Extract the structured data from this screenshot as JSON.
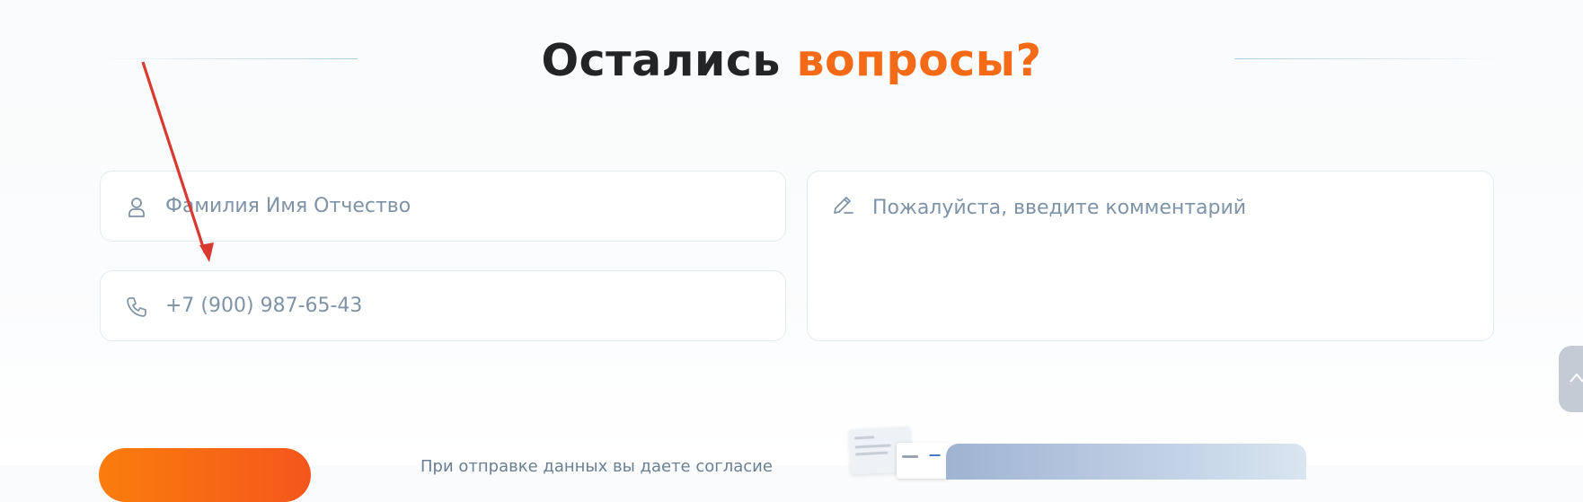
{
  "header": {
    "title_main": "Остались",
    "title_accent": "вопросы?"
  },
  "form": {
    "name_placeholder": "Фамилия Имя Отчество",
    "phone_placeholder": "+7 (900) 987-65-43",
    "comment_placeholder": "Пожалуйста, введите комментарий"
  },
  "footer": {
    "consent_text": "При отправке данных вы даете согласие"
  },
  "icons": {
    "name": "user-icon",
    "phone": "phone-icon",
    "comment": "pencil-icon",
    "scroll_top": "chevron-up-icon"
  },
  "colors": {
    "accent": "#f46a16",
    "title": "#222426",
    "placeholder": "#7e93a6",
    "annotation_arrow": "#d93a2f"
  }
}
